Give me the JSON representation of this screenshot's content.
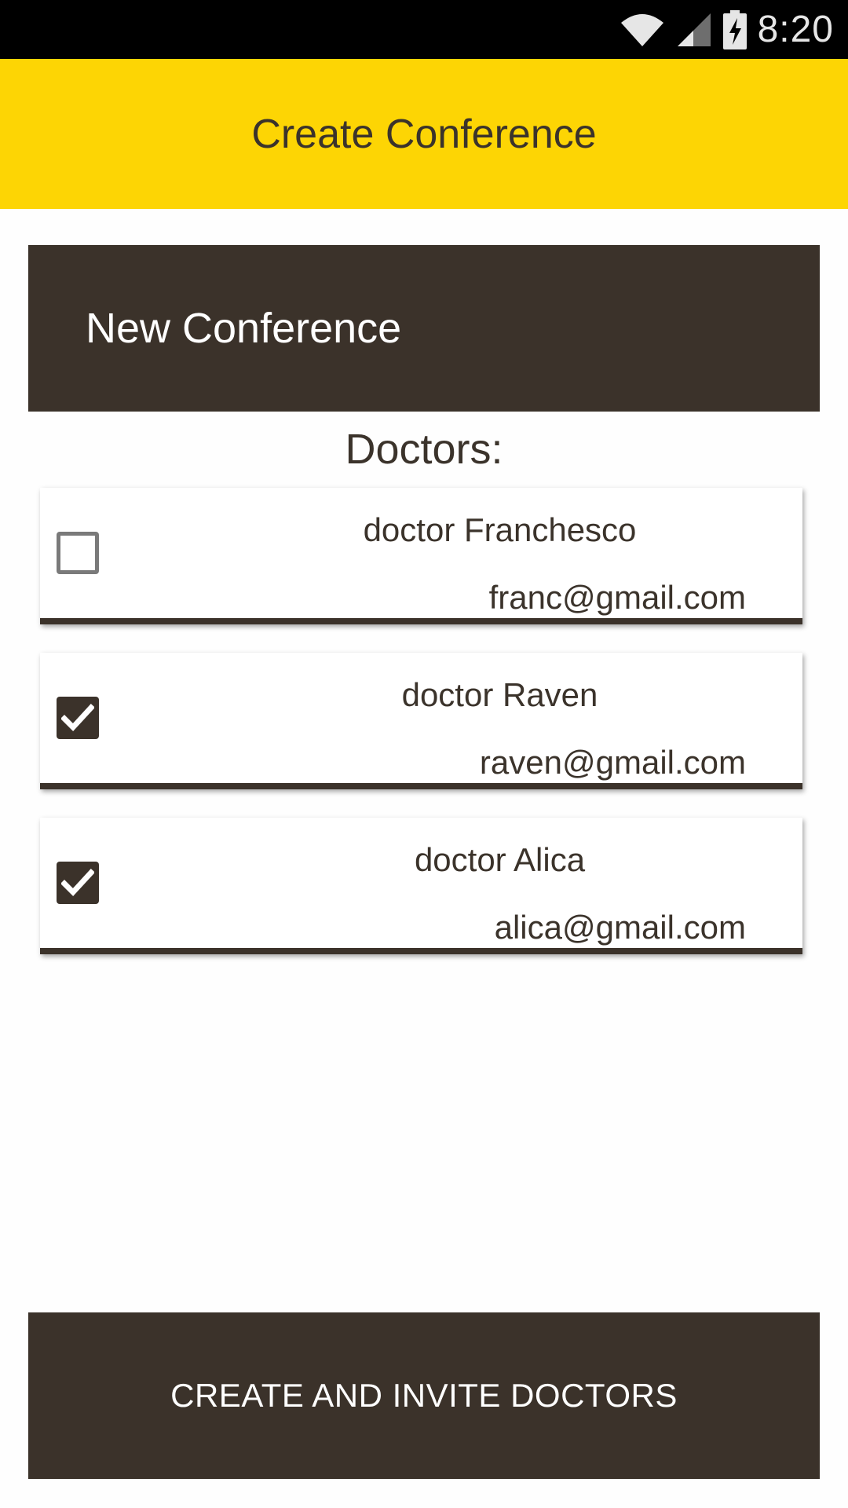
{
  "status_bar": {
    "time": "8:20",
    "icons": [
      "wifi-icon",
      "signal-icon",
      "battery-charging-icon"
    ]
  },
  "app_bar": {
    "title": "Create Conference"
  },
  "conference": {
    "title": "New Conference"
  },
  "doctors_section": {
    "label": "Doctors:"
  },
  "doctors": [
    {
      "name": "doctor Franchesco",
      "email": "franc@gmail.com",
      "checked": false
    },
    {
      "name": "doctor Raven",
      "email": "raven@gmail.com",
      "checked": true
    },
    {
      "name": "doctor Alica",
      "email": "alica@gmail.com",
      "checked": true
    }
  ],
  "actions": {
    "create_label": "CREATE AND INVITE DOCTORS"
  },
  "colors": {
    "accent_yellow": "#fdd504",
    "dark_brown": "#3b322a",
    "status_bar": "#000000"
  }
}
